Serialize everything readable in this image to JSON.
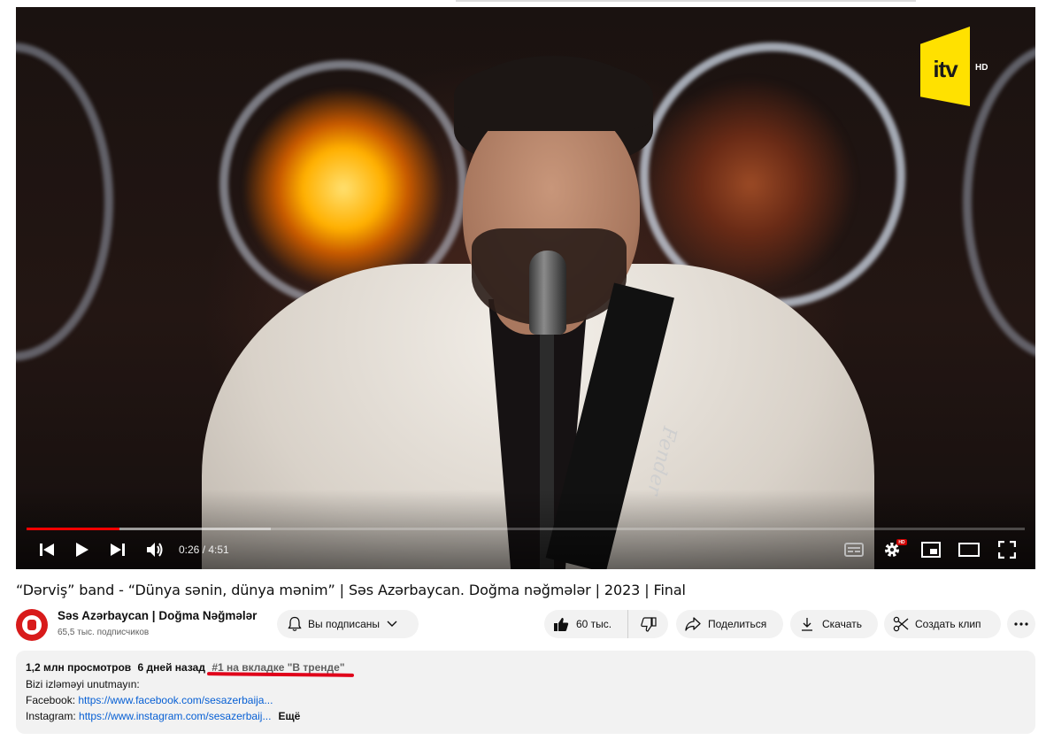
{
  "player": {
    "logo": "itv",
    "logo_quality": "HD",
    "time_current": "0:26",
    "time_separator": " / ",
    "time_total": "4:51",
    "progress_played_fraction": 0.093,
    "progress_buffered_fraction": 0.245,
    "guitar_strap_text": "Fender",
    "quality_badge": "HD",
    "icons": [
      "previous-icon",
      "play-icon",
      "next-icon",
      "volume-icon",
      "subtitles-icon",
      "settings-icon",
      "miniplayer-icon",
      "theater-mode-icon",
      "fullscreen-icon"
    ]
  },
  "video": {
    "title": "“Dərviş” band - “Dünya sənin, dünya mənim” | Səs Azərbaycan. Doğma nəğmələr | 2023 | Final"
  },
  "channel": {
    "name": "Səs Azərbaycan | Doğma Nəğmələr",
    "subscribers": "65,5 тыс. подписчиков",
    "avatar_color": "#d81b1b"
  },
  "actions": {
    "subscribed_label": "Вы подписаны",
    "likes": "60 тыс.",
    "share_label": "Поделиться",
    "download_label": "Скачать",
    "clip_label": "Создать клип"
  },
  "description": {
    "views": "1,2 млн просмотров",
    "date": "6 дней назад",
    "trending": "#1 на вкладке \"В тренде\"",
    "line1": "Bizi izləməyi unutmayın:",
    "facebook_label": "Facebook: ",
    "facebook_link": "https://www.facebook.com/sesazerbaija...",
    "instagram_label": "Instagram: ",
    "instagram_link": "https://www.instagram.com/sesazerbaij...",
    "more_label": "Ещё"
  },
  "colors": {
    "accent_red": "#ff0000",
    "link_blue": "#065fd4",
    "logo_yellow": "#ffe100",
    "annotation_red": "#e0001a"
  }
}
